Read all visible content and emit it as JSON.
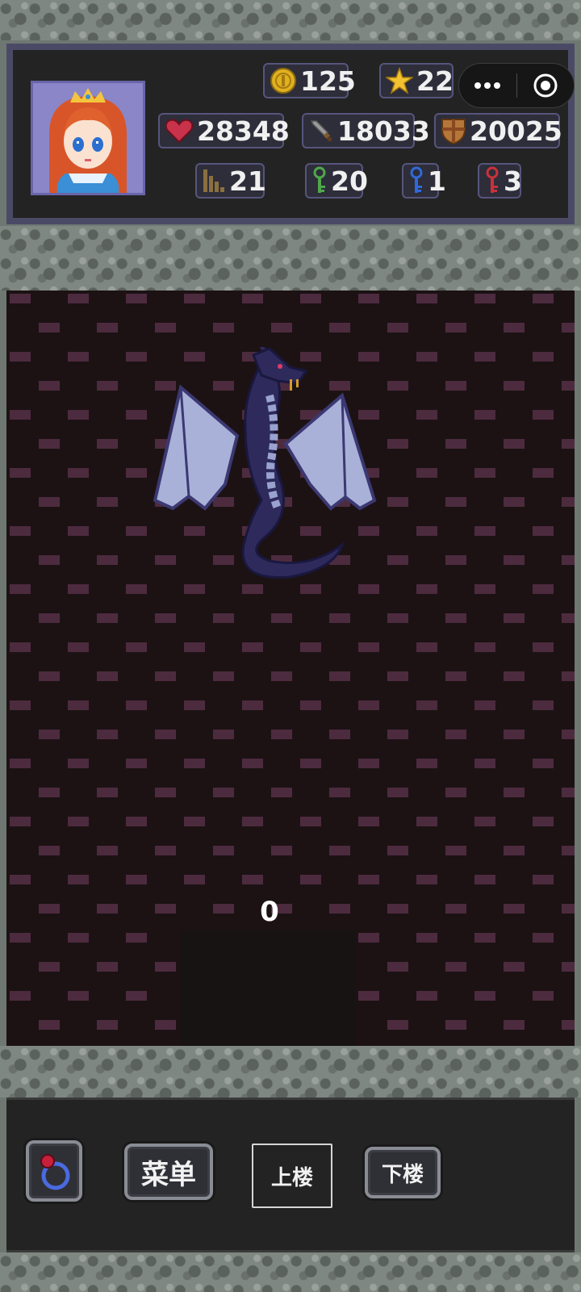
{
  "hud": {
    "gold": "125",
    "stars": "22",
    "hp": "28348",
    "attack": "18033",
    "defense": "20025",
    "floor": "21",
    "green_keys": "20",
    "blue_keys": "1",
    "red_keys": "3"
  },
  "capsule": {
    "more_icon": "ellipsis-icon",
    "close_icon": "target-circle-icon"
  },
  "board": {
    "damage": "0"
  },
  "controls": {
    "menu_label": "菜单",
    "up_label": "上楼",
    "down_label": "下楼"
  },
  "colors": {
    "hud_frame": "#4b4a66",
    "stat_border": "#56557c",
    "wall_brick": "#4d2b3f",
    "wall_bg": "#1c1213",
    "dragon": "#2e2b5c",
    "dragon_wing": "#a9b1d8"
  }
}
